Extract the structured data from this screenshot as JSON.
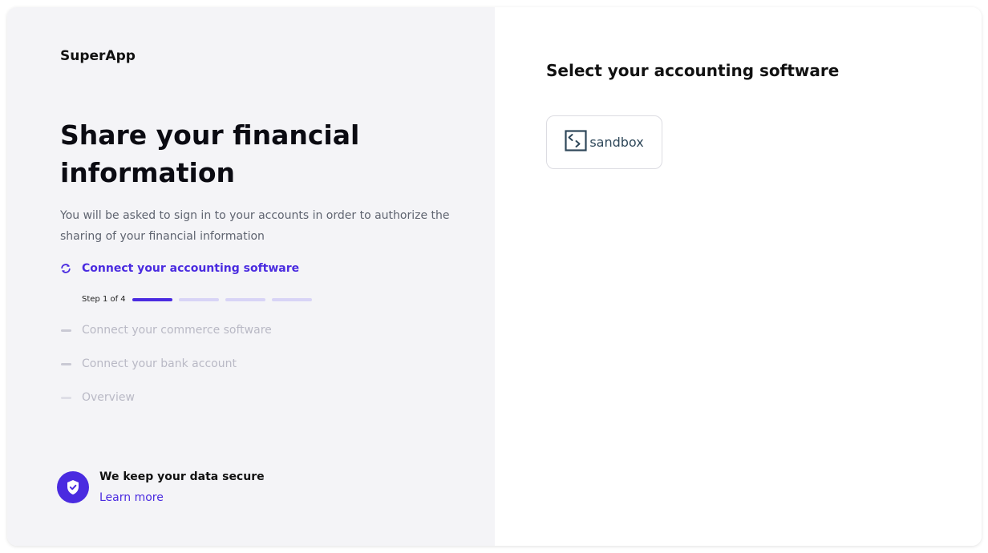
{
  "brand": "SuperApp",
  "headline": "Share your financial information",
  "subtitle": "You will be asked to sign in to your accounts in order to authorize the sharing of your financial information",
  "steps": [
    {
      "label": "Connect your accounting software",
      "status": "active",
      "icon": "refresh-icon"
    },
    {
      "label": "Connect your commerce software",
      "status": "pending",
      "icon": "dash-icon"
    },
    {
      "label": "Connect your bank account",
      "status": "pending",
      "icon": "dash-icon"
    },
    {
      "label": "Overview",
      "status": "pending",
      "icon": "dash-icon"
    }
  ],
  "progress": {
    "text": "Step 1 of 4",
    "current": 1,
    "total": 4
  },
  "secure": {
    "title": "We keep your data secure",
    "link": "Learn more",
    "icon": "shield-check-icon"
  },
  "right": {
    "title": "Select your accounting software",
    "options": [
      {
        "label": "sandbox",
        "icon": "sandbox-logo-icon"
      }
    ]
  },
  "colors": {
    "accent": "#4a2be0",
    "left_bg": "#f4f4f7",
    "muted": "#b9b9c5"
  }
}
